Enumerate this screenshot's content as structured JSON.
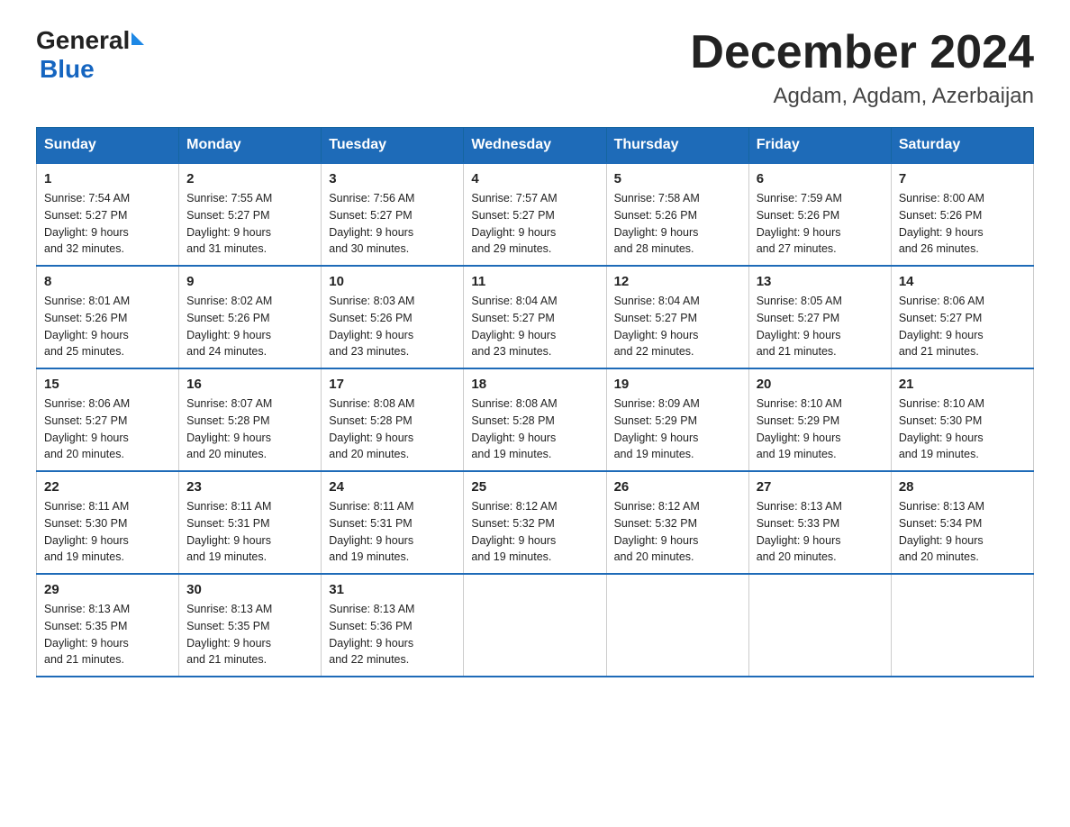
{
  "logo": {
    "general": "General",
    "blue": "Blue"
  },
  "title": "December 2024",
  "location": "Agdam, Agdam, Azerbaijan",
  "days_of_week": [
    "Sunday",
    "Monday",
    "Tuesday",
    "Wednesday",
    "Thursday",
    "Friday",
    "Saturday"
  ],
  "weeks": [
    [
      {
        "day": "1",
        "sunrise": "7:54 AM",
        "sunset": "5:27 PM",
        "daylight": "9 hours and 32 minutes."
      },
      {
        "day": "2",
        "sunrise": "7:55 AM",
        "sunset": "5:27 PM",
        "daylight": "9 hours and 31 minutes."
      },
      {
        "day": "3",
        "sunrise": "7:56 AM",
        "sunset": "5:27 PM",
        "daylight": "9 hours and 30 minutes."
      },
      {
        "day": "4",
        "sunrise": "7:57 AM",
        "sunset": "5:27 PM",
        "daylight": "9 hours and 29 minutes."
      },
      {
        "day": "5",
        "sunrise": "7:58 AM",
        "sunset": "5:26 PM",
        "daylight": "9 hours and 28 minutes."
      },
      {
        "day": "6",
        "sunrise": "7:59 AM",
        "sunset": "5:26 PM",
        "daylight": "9 hours and 27 minutes."
      },
      {
        "day": "7",
        "sunrise": "8:00 AM",
        "sunset": "5:26 PM",
        "daylight": "9 hours and 26 minutes."
      }
    ],
    [
      {
        "day": "8",
        "sunrise": "8:01 AM",
        "sunset": "5:26 PM",
        "daylight": "9 hours and 25 minutes."
      },
      {
        "day": "9",
        "sunrise": "8:02 AM",
        "sunset": "5:26 PM",
        "daylight": "9 hours and 24 minutes."
      },
      {
        "day": "10",
        "sunrise": "8:03 AM",
        "sunset": "5:26 PM",
        "daylight": "9 hours and 23 minutes."
      },
      {
        "day": "11",
        "sunrise": "8:04 AM",
        "sunset": "5:27 PM",
        "daylight": "9 hours and 23 minutes."
      },
      {
        "day": "12",
        "sunrise": "8:04 AM",
        "sunset": "5:27 PM",
        "daylight": "9 hours and 22 minutes."
      },
      {
        "day": "13",
        "sunrise": "8:05 AM",
        "sunset": "5:27 PM",
        "daylight": "9 hours and 21 minutes."
      },
      {
        "day": "14",
        "sunrise": "8:06 AM",
        "sunset": "5:27 PM",
        "daylight": "9 hours and 21 minutes."
      }
    ],
    [
      {
        "day": "15",
        "sunrise": "8:06 AM",
        "sunset": "5:27 PM",
        "daylight": "9 hours and 20 minutes."
      },
      {
        "day": "16",
        "sunrise": "8:07 AM",
        "sunset": "5:28 PM",
        "daylight": "9 hours and 20 minutes."
      },
      {
        "day": "17",
        "sunrise": "8:08 AM",
        "sunset": "5:28 PM",
        "daylight": "9 hours and 20 minutes."
      },
      {
        "day": "18",
        "sunrise": "8:08 AM",
        "sunset": "5:28 PM",
        "daylight": "9 hours and 19 minutes."
      },
      {
        "day": "19",
        "sunrise": "8:09 AM",
        "sunset": "5:29 PM",
        "daylight": "9 hours and 19 minutes."
      },
      {
        "day": "20",
        "sunrise": "8:10 AM",
        "sunset": "5:29 PM",
        "daylight": "9 hours and 19 minutes."
      },
      {
        "day": "21",
        "sunrise": "8:10 AM",
        "sunset": "5:30 PM",
        "daylight": "9 hours and 19 minutes."
      }
    ],
    [
      {
        "day": "22",
        "sunrise": "8:11 AM",
        "sunset": "5:30 PM",
        "daylight": "9 hours and 19 minutes."
      },
      {
        "day": "23",
        "sunrise": "8:11 AM",
        "sunset": "5:31 PM",
        "daylight": "9 hours and 19 minutes."
      },
      {
        "day": "24",
        "sunrise": "8:11 AM",
        "sunset": "5:31 PM",
        "daylight": "9 hours and 19 minutes."
      },
      {
        "day": "25",
        "sunrise": "8:12 AM",
        "sunset": "5:32 PM",
        "daylight": "9 hours and 19 minutes."
      },
      {
        "day": "26",
        "sunrise": "8:12 AM",
        "sunset": "5:32 PM",
        "daylight": "9 hours and 20 minutes."
      },
      {
        "day": "27",
        "sunrise": "8:13 AM",
        "sunset": "5:33 PM",
        "daylight": "9 hours and 20 minutes."
      },
      {
        "day": "28",
        "sunrise": "8:13 AM",
        "sunset": "5:34 PM",
        "daylight": "9 hours and 20 minutes."
      }
    ],
    [
      {
        "day": "29",
        "sunrise": "8:13 AM",
        "sunset": "5:35 PM",
        "daylight": "9 hours and 21 minutes."
      },
      {
        "day": "30",
        "sunrise": "8:13 AM",
        "sunset": "5:35 PM",
        "daylight": "9 hours and 21 minutes."
      },
      {
        "day": "31",
        "sunrise": "8:13 AM",
        "sunset": "5:36 PM",
        "daylight": "9 hours and 22 minutes."
      },
      null,
      null,
      null,
      null
    ]
  ]
}
